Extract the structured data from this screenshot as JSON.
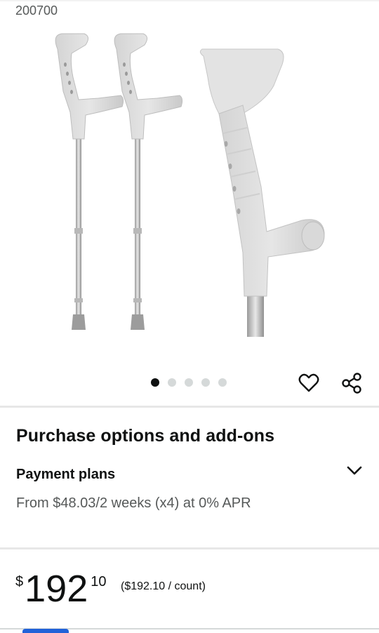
{
  "product": {
    "model_id": "200700"
  },
  "gallery": {
    "image_alt": "Forearm crutches",
    "image_count": 5,
    "active_index": 0
  },
  "actions": {
    "favorite_icon": "heart-icon",
    "share_icon": "share-icon"
  },
  "purchase_options": {
    "title": "Purchase options and add-ons",
    "payment_plans": {
      "title": "Payment plans",
      "description": "From $48.03/2 weeks (x4) at 0% APR",
      "expand_icon": "chevron-down-icon"
    }
  },
  "price": {
    "symbol": "$",
    "whole": "192",
    "fraction": "10",
    "unit_price": "($192.10 / count)"
  },
  "colors": {
    "accent_blue": "#2162d9",
    "text_primary": "#0f1111",
    "text_secondary": "#565959",
    "divider": "#e7e7e7"
  }
}
